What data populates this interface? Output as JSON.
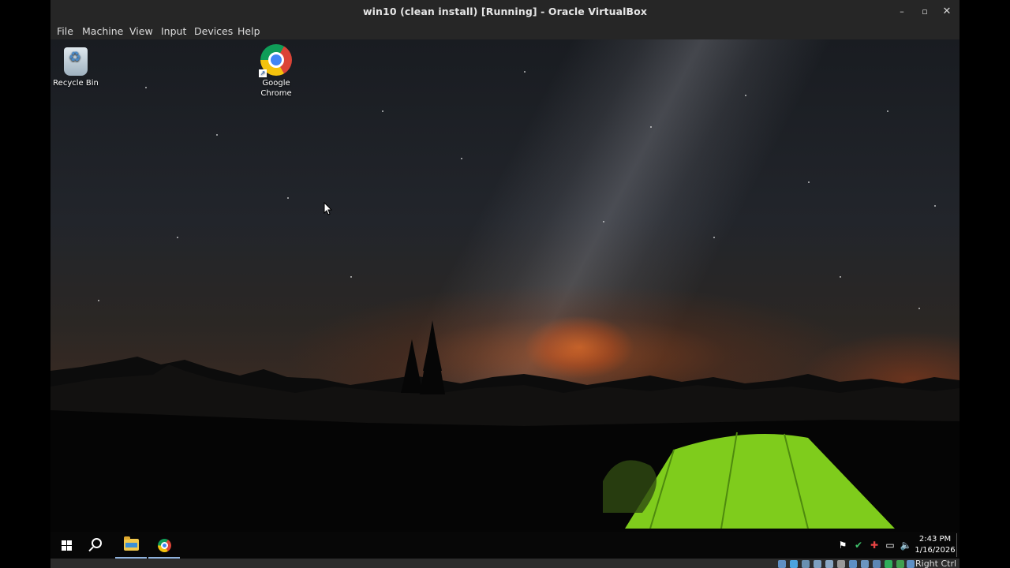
{
  "window": {
    "title": "win10 (clean install) [Running] - Oracle VirtualBox",
    "minimize_glyph": "–",
    "maximize_glyph": "▫",
    "close_glyph": "✕"
  },
  "menubar": {
    "items": [
      {
        "label": "File"
      },
      {
        "label": "Machine"
      },
      {
        "label": "View"
      },
      {
        "label": "Input"
      },
      {
        "label": "Devices"
      },
      {
        "label": "Help"
      }
    ]
  },
  "desktop": {
    "icons": [
      {
        "label": "Recycle Bin",
        "icon": "recycle-bin-icon"
      },
      {
        "label": "Google\nChrome",
        "icon": "chrome-icon"
      }
    ]
  },
  "taskbar": {
    "buttons": [
      {
        "icon": "windows-start-icon"
      },
      {
        "icon": "search-icon"
      },
      {
        "icon": "file-explorer-icon",
        "active": true
      },
      {
        "icon": "chrome-icon",
        "active": true
      }
    ],
    "tray_icons": [
      "app-tray-icon",
      "vpn-icon",
      "security-icon",
      "network-icon",
      "volume-icon"
    ],
    "clock": {
      "time": "2:43 PM",
      "date": "1/16/2026"
    }
  },
  "statusbar": {
    "host_key_label": "Right Ctrl"
  },
  "colors": {
    "titlebar_bg": "#262626",
    "taskbar_bg": "#070707",
    "tent_green": "#7fcc1c",
    "horizon_orange": "#e06a1f"
  }
}
